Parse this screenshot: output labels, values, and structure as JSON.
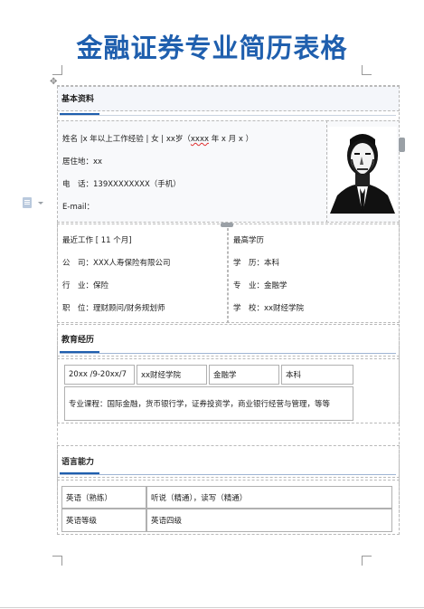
{
  "doc_title": "金融证券专业简历表格",
  "sections": {
    "basic": "基本资料",
    "education": "教育经历",
    "language": "语言能力"
  },
  "profile": {
    "name_line_prefix": "姓名 |x 年以上工作经验 | 女 | xx岁（",
    "name_line_wavy": "xxxx",
    "name_line_suffix": " 年 x 月 x ）",
    "residence": "居住地：xx",
    "phone": "电　话：139XXXXXXXX（手机）",
    "email": "E-mail："
  },
  "work": {
    "recent": "最近工作 [ 11 个月]",
    "company": "公　司：XXX人寿保险有限公司",
    "industry": "行　业：保险",
    "position": "职　位：理财顾问/财务规划师"
  },
  "degree": {
    "highest": "最高学历",
    "level": "学　历：本科",
    "major": "专　业：金融学",
    "school": "学　校：xx财经学院"
  },
  "education_table": {
    "row1": [
      "20xx /9-20xx/7",
      "xx财经学院",
      "金融学",
      "本科"
    ],
    "courses": "专业课程：国际金融，货币银行学，证券投资学，商业银行经营与管理，等等"
  },
  "language_table": [
    [
      "英语（熟练）",
      "听说（精通），读写（精通）"
    ],
    [
      "英语等级",
      "英语四级"
    ]
  ],
  "icons": {
    "move": "move-handle-icon",
    "file": "document-icon",
    "photo": "profile-photo"
  }
}
